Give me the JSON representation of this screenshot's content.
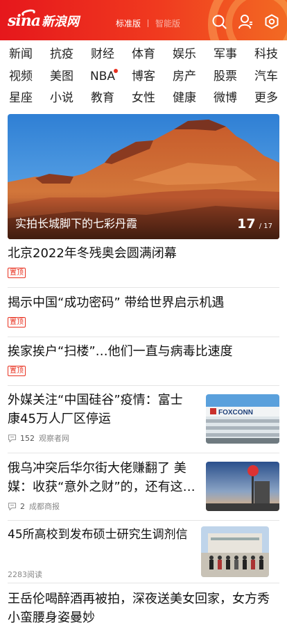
{
  "header": {
    "logo_sina": "sina",
    "logo_cn": "新浪网",
    "mode_standard": "标准版",
    "mode_smart": "智能版",
    "icons": [
      "search-icon",
      "user-icon",
      "settings-icon"
    ],
    "colors": {
      "primary": "#e6171c",
      "accent": "#f26a23"
    }
  },
  "channels": [
    "新闻",
    "抗疫",
    "财经",
    "体育",
    "娱乐",
    "军事",
    "科技",
    "视频",
    "美图",
    "NBA",
    "博客",
    "房产",
    "股票",
    "汽车",
    "星座",
    "小说",
    "教育",
    "女性",
    "健康",
    "微博",
    "更多"
  ],
  "hero": {
    "caption": "实拍长城脚下的七彩丹霞",
    "current": "17",
    "total": "/ 17"
  },
  "feed": {
    "pinned_tag": "置顶",
    "items": [
      {
        "title": "北京2022年冬残奥会圆满闭幕"
      },
      {
        "title": "揭示中国“成功密码” 带给世界启示机遇"
      },
      {
        "title": "挨家挨户“扫楼”…他们一直与病毒比速度"
      },
      {
        "title": "外媒关注“中国硅谷”疫情：富士康45万人厂区停运",
        "comments": "152",
        "source": "观察者网",
        "thumb_text": "FOXCONN"
      },
      {
        "title": "俄乌冲突后华尔街大佬赚翻了 美媒：收获“意外之财”的，还有这…",
        "comments": "2",
        "source": "成都商报"
      },
      {
        "title": "45所高校到发布硕士研究生调剂信",
        "reads": "2283阅读"
      },
      {
        "title": "王岳伦喝醉酒再被拍，深夜送美女回家，女方秀小蛮腰身姿曼妙"
      }
    ]
  }
}
